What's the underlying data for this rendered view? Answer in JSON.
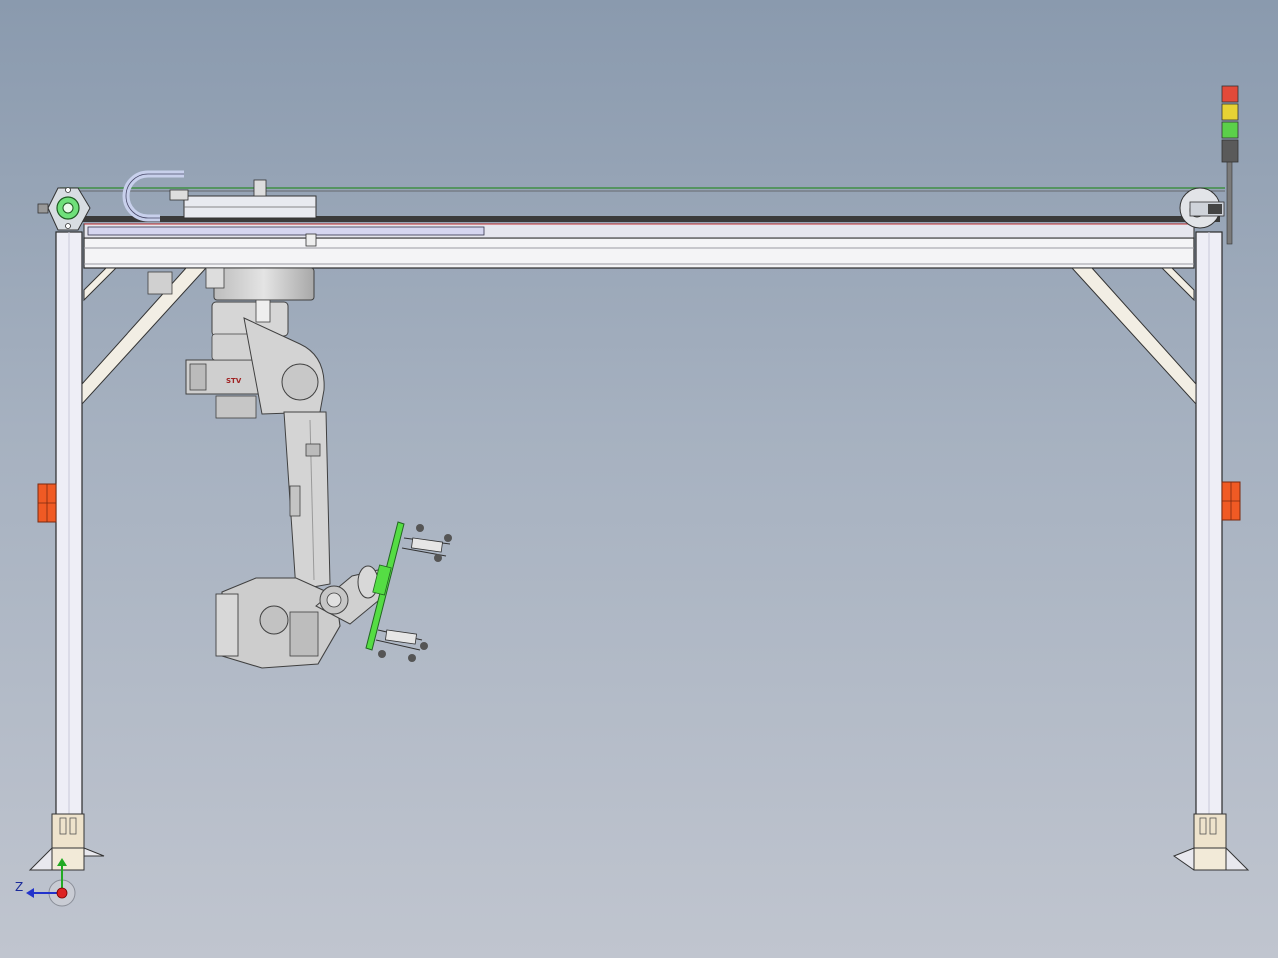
{
  "view": {
    "background_top": "#8a9aae",
    "background_bottom": "#c0c5cf"
  },
  "robot": {
    "badge_text": "STV",
    "body_color": "#d4d4d4",
    "edge_color": "#404040"
  },
  "gantry": {
    "frame_color": "#f2f2f5",
    "rail_color": "#dcdce6",
    "brace_color": "#f0ece2"
  },
  "end_effector": {
    "plate_color": "#55dd44"
  },
  "stack_light": {
    "levels": [
      "red",
      "yellow",
      "green",
      "off"
    ],
    "colors": [
      "#e24a3a",
      "#e6d234",
      "#5bd04a",
      "#5a5a5a"
    ]
  },
  "side_markers": {
    "color": "#f05a24"
  },
  "triad": {
    "axis_label": "Z",
    "icon": "coordinate-triad-icon"
  }
}
